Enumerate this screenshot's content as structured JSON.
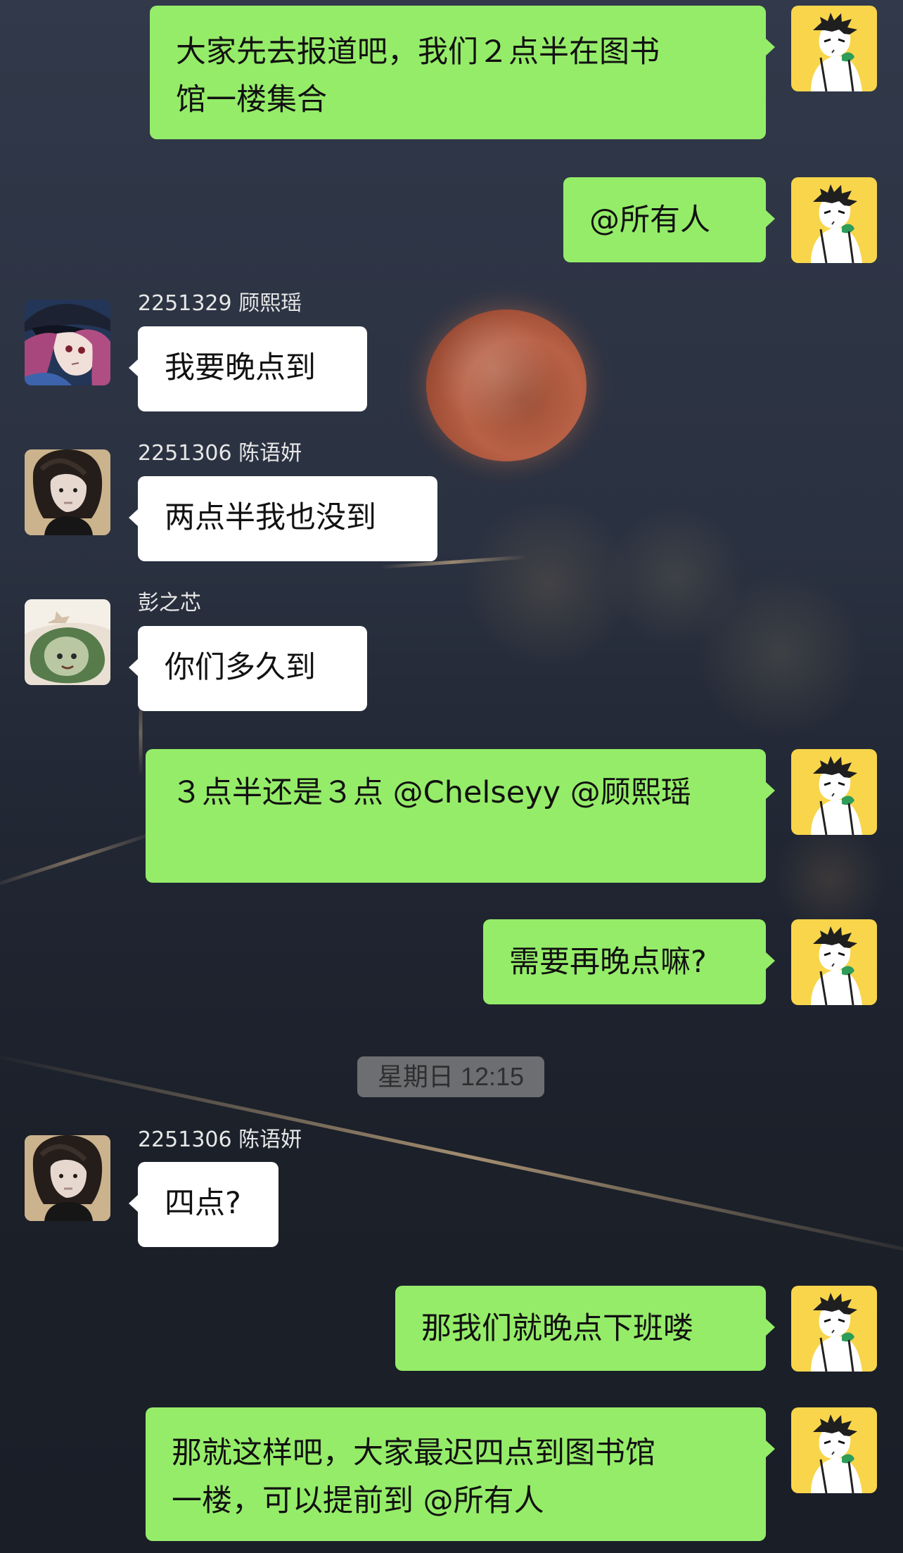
{
  "messages": [
    {
      "direction": "out",
      "sender": "",
      "text": "大家先去报道吧，我们２点半在图书\n馆一楼集合"
    },
    {
      "direction": "out",
      "sender": "",
      "text": "@所有人"
    },
    {
      "direction": "in",
      "sender": "2251329 顾熙瑶",
      "text": "我要晚点到"
    },
    {
      "direction": "in",
      "sender": "2251306 陈语妍",
      "text": "两点半我也没到"
    },
    {
      "direction": "in",
      "sender": "彭之芯",
      "text": "你们多久到"
    },
    {
      "direction": "out",
      "sender": "",
      "text": "３点半还是３点 @Chelseyy @顾熙瑶"
    },
    {
      "direction": "out",
      "sender": "",
      "text": "需要再晚点嘛?"
    },
    {
      "direction": "in",
      "sender": "2251306 陈语妍",
      "text": "四点?"
    },
    {
      "direction": "out",
      "sender": "",
      "text": "那我们就晚点下班喽"
    },
    {
      "direction": "out",
      "sender": "",
      "text": "那就这样吧，大家最迟四点到图书馆\n一楼，可以提前到 @所有人"
    }
  ],
  "timestamp": "星期日 12:15",
  "colors": {
    "outgoing_bubble": "#95ec69",
    "incoming_bubble": "#ffffff",
    "sender_name": "#e7e7e7"
  },
  "avatar_icons": {
    "self": "anime-character-avatar-icon",
    "guxiyao": "anime-character-avatar-icon",
    "chenyuyan": "person-photo-avatar-icon",
    "pengzhixin": "plush-toy-avatar-icon"
  }
}
